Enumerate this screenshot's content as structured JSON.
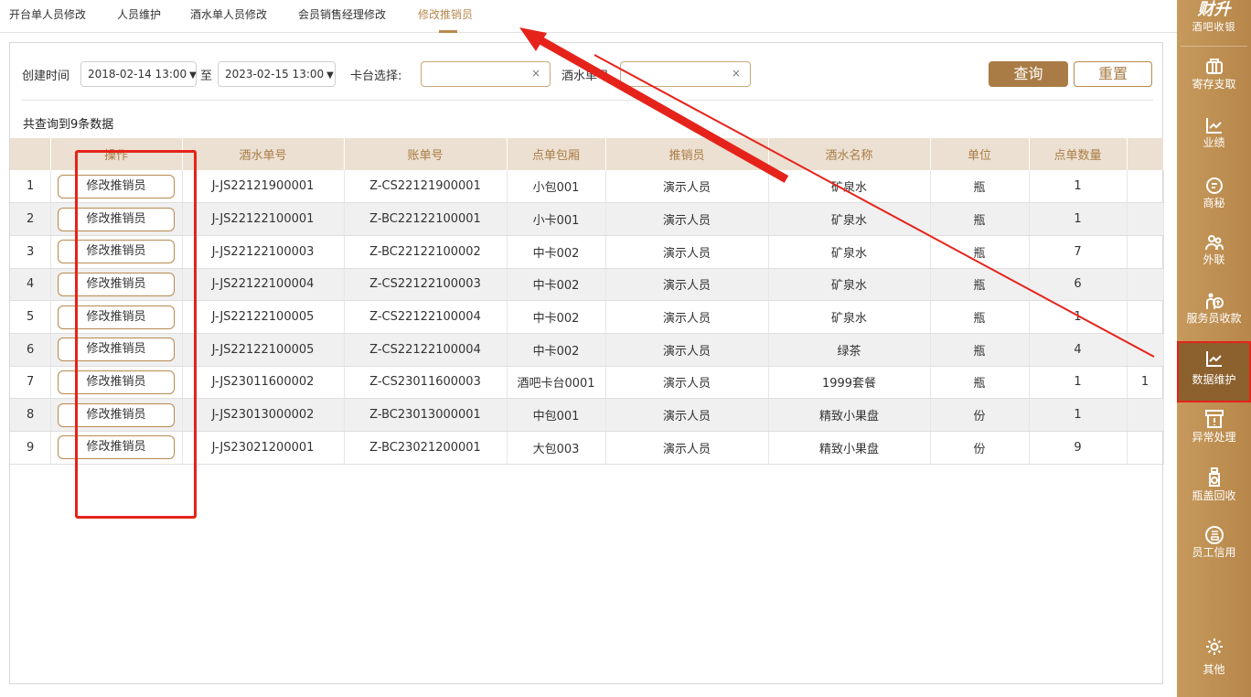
{
  "tabs": [
    {
      "label": "开台单人员修改"
    },
    {
      "label": "人员维护"
    },
    {
      "label": "酒水单人员修改"
    },
    {
      "label": "会员销售经理修改"
    },
    {
      "label": "修改推销员",
      "active": true
    }
  ],
  "filter": {
    "created_label": "创建时间",
    "start_date": "2018-02-14 13:00",
    "to_label": "至",
    "end_date": "2023-02-15 13:00",
    "table_select_label": "卡台选择:",
    "table_select_value": "",
    "drink_no_label": "酒水单号",
    "drink_no_value": "",
    "query_button": "查询",
    "reset_button": "重置",
    "clear_icon": "×"
  },
  "result_count": "共查询到9条数据",
  "table": {
    "headers": [
      "",
      "操作",
      "酒水单号",
      "账单号",
      "点单包厢",
      "推销员",
      "酒水名称",
      "单位",
      "点单数量",
      ""
    ],
    "action_label": "修改推销员",
    "rows": [
      {
        "idx": "1",
        "drink_no": "J-JS22121900001",
        "bill_no": "Z-CS22121900001",
        "room": "小包001",
        "salesman": "演示人员",
        "drink": "矿泉水",
        "unit": "瓶",
        "qty": "1",
        "extra": ""
      },
      {
        "idx": "2",
        "drink_no": "J-JS22122100001",
        "bill_no": "Z-BC22122100001",
        "room": "小卡001",
        "salesman": "演示人员",
        "drink": "矿泉水",
        "unit": "瓶",
        "qty": "1",
        "extra": ""
      },
      {
        "idx": "3",
        "drink_no": "J-JS22122100003",
        "bill_no": "Z-BC22122100002",
        "room": "中卡002",
        "salesman": "演示人员",
        "drink": "矿泉水",
        "unit": "瓶",
        "qty": "7",
        "extra": ""
      },
      {
        "idx": "4",
        "drink_no": "J-JS22122100004",
        "bill_no": "Z-CS22122100003",
        "room": "中卡002",
        "salesman": "演示人员",
        "drink": "矿泉水",
        "unit": "瓶",
        "qty": "6",
        "extra": ""
      },
      {
        "idx": "5",
        "drink_no": "J-JS22122100005",
        "bill_no": "Z-CS22122100004",
        "room": "中卡002",
        "salesman": "演示人员",
        "drink": "矿泉水",
        "unit": "瓶",
        "qty": "1",
        "extra": ""
      },
      {
        "idx": "6",
        "drink_no": "J-JS22122100005",
        "bill_no": "Z-CS22122100004",
        "room": "中卡002",
        "salesman": "演示人员",
        "drink": "绿茶",
        "unit": "瓶",
        "qty": "4",
        "extra": ""
      },
      {
        "idx": "7",
        "drink_no": "J-JS23011600002",
        "bill_no": "Z-CS23011600003",
        "room": "酒吧卡台0001",
        "salesman": "演示人员",
        "drink": "1999套餐",
        "unit": "瓶",
        "qty": "1",
        "extra": "1"
      },
      {
        "idx": "8",
        "drink_no": "J-JS23013000002",
        "bill_no": "Z-BC23013000001",
        "room": "中包001",
        "salesman": "演示人员",
        "drink": "精致小果盘",
        "unit": "份",
        "qty": "1",
        "extra": ""
      },
      {
        "idx": "9",
        "drink_no": "J-JS23021200001",
        "bill_no": "Z-BC23021200001",
        "room": "大包003",
        "salesman": "演示人员",
        "drink": "精致小果盘",
        "unit": "份",
        "qty": "9",
        "extra": ""
      }
    ]
  },
  "sidebar": {
    "brand": "财升",
    "brand_sub": "酒吧收银",
    "items": [
      {
        "label": "寄存支取",
        "icon": "storage-icon"
      },
      {
        "label": "业绩",
        "icon": "chart-icon"
      },
      {
        "label": "商秘",
        "icon": "secretary-icon"
      },
      {
        "label": "外联",
        "icon": "people-icon"
      },
      {
        "label": "服务员收款",
        "icon": "waiter-pay-icon"
      },
      {
        "label": "数据维护",
        "icon": "chart-icon",
        "active": true
      },
      {
        "label": "异常处理",
        "icon": "alert-icon"
      },
      {
        "label": "瓶盖回收",
        "icon": "bottle-icon"
      },
      {
        "label": "员工信用",
        "icon": "credit-icon"
      },
      {
        "label": "其他",
        "icon": "gear-icon"
      }
    ]
  },
  "colors": {
    "accent": "#b8894f",
    "sidebar": "#bf9152",
    "table_header_bg": "#ece0d2",
    "annotation": "#e5231b"
  }
}
